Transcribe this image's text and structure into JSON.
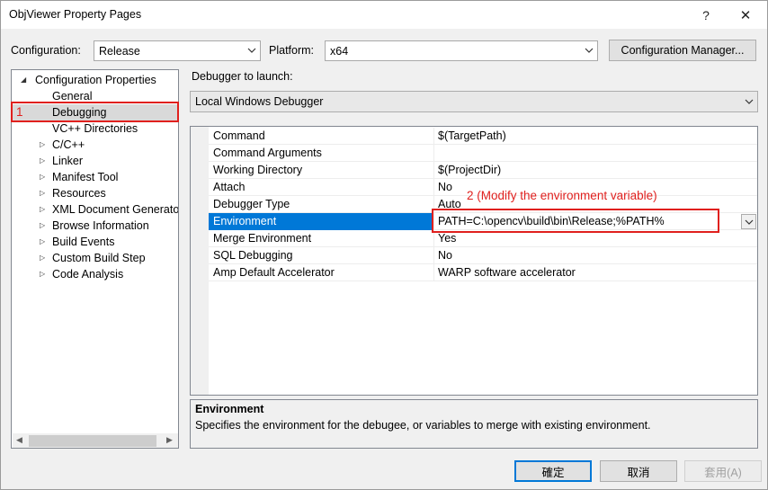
{
  "window": {
    "title": "ObjViewer Property Pages",
    "help_glyph": "?",
    "close_glyph": "✕"
  },
  "toolbar": {
    "configuration_label": "Configuration:",
    "configuration_value": "Release",
    "platform_label": "Platform:",
    "platform_value": "x64",
    "config_manager_label": "Configuration Manager..."
  },
  "tree": {
    "root_label": "Configuration Properties",
    "items": [
      {
        "label": "General"
      },
      {
        "label": "Debugging"
      },
      {
        "label": "VC++ Directories"
      },
      {
        "label": "C/C++"
      },
      {
        "label": "Linker"
      },
      {
        "label": "Manifest Tool"
      },
      {
        "label": "Resources"
      },
      {
        "label": "XML Document Generator"
      },
      {
        "label": "Browse Information"
      },
      {
        "label": "Build Events"
      },
      {
        "label": "Custom Build Step"
      },
      {
        "label": "Code Analysis"
      }
    ],
    "annotation_number": "1"
  },
  "debugger": {
    "label": "Debugger to launch:",
    "value": "Local Windows Debugger"
  },
  "properties": [
    {
      "name": "Command",
      "value": "$(TargetPath)"
    },
    {
      "name": "Command Arguments",
      "value": ""
    },
    {
      "name": "Working Directory",
      "value": "$(ProjectDir)"
    },
    {
      "name": "Attach",
      "value": "No"
    },
    {
      "name": "Debugger Type",
      "value": "Auto"
    },
    {
      "name": "Environment",
      "value": "PATH=C:\\opencv\\build\\bin\\Release;%PATH%"
    },
    {
      "name": "Merge Environment",
      "value": "Yes"
    },
    {
      "name": "SQL Debugging",
      "value": "No"
    },
    {
      "name": "Amp Default Accelerator",
      "value": "WARP software accelerator"
    }
  ],
  "annotation_2": "2 (Modify the environment variable)",
  "description": {
    "title": "Environment",
    "text": "Specifies the environment for the debugee, or variables to merge with existing environment."
  },
  "buttons": {
    "ok": "確定",
    "cancel": "取消",
    "apply": "套用(A)"
  },
  "colors": {
    "accent": "#0078d7",
    "annotation_red": "#e0201e"
  }
}
